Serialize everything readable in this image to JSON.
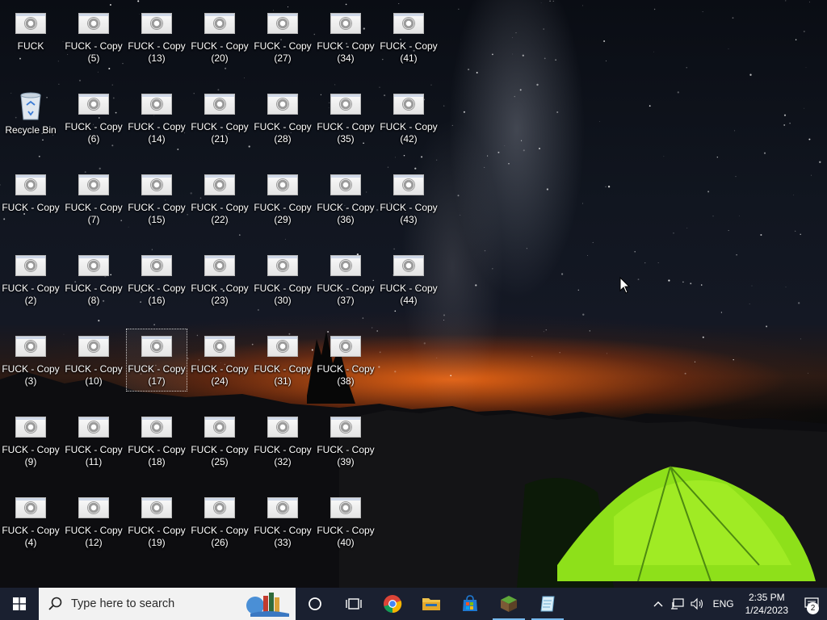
{
  "desktop": {
    "icons": [
      {
        "label": "FUCK"
      },
      {
        "label": "Recycle Bin"
      },
      {
        "label": "FUCK - Copy"
      },
      {
        "label": "FUCK - Copy\n(2)"
      },
      {
        "label": "FUCK - Copy\n(3)"
      },
      {
        "label": "FUCK - Copy\n(9)"
      },
      {
        "label": "FUCK - Copy\n(4)"
      },
      {
        "label": "FUCK - Copy\n(5)"
      },
      {
        "label": "FUCK - Copy\n(6)"
      },
      {
        "label": "FUCK - Copy\n(7)"
      },
      {
        "label": "FUCK - Copy\n(8)"
      },
      {
        "label": "FUCK - Copy\n(10)"
      },
      {
        "label": "FUCK - Copy\n(11)"
      },
      {
        "label": "FUCK - Copy\n(12)"
      },
      {
        "label": "FUCK - Copy\n(13)"
      },
      {
        "label": "FUCK - Copy\n(14)"
      },
      {
        "label": "FUCK - Copy\n(15)"
      },
      {
        "label": "FUCK - Copy\n(16)"
      },
      {
        "label": "FUCK - Copy\n(17)",
        "selected": true
      },
      {
        "label": "FUCK - Copy\n(18)"
      },
      {
        "label": "FUCK - Copy\n(19)"
      },
      {
        "label": "FUCK - Copy\n(20)"
      },
      {
        "label": "FUCK - Copy\n(21)"
      },
      {
        "label": "FUCK - Copy\n(22)"
      },
      {
        "label": "FUCK - Copy\n(23)"
      },
      {
        "label": "FUCK - Copy\n(24)"
      },
      {
        "label": "FUCK - Copy\n(25)"
      },
      {
        "label": "FUCK - Copy\n(26)"
      },
      {
        "label": "FUCK - Copy\n(27)"
      },
      {
        "label": "FUCK - Copy\n(28)"
      },
      {
        "label": "FUCK - Copy\n(29)"
      },
      {
        "label": "FUCK - Copy\n(30)"
      },
      {
        "label": "FUCK - Copy\n(31)"
      },
      {
        "label": "FUCK - Copy\n(32)"
      },
      {
        "label": "FUCK - Copy\n(33)"
      },
      {
        "label": "FUCK - Copy\n(34)"
      },
      {
        "label": "FUCK - Copy\n(35)"
      },
      {
        "label": "FUCK - Copy\n(36)"
      },
      {
        "label": "FUCK - Copy\n(37)"
      },
      {
        "label": "FUCK - Copy\n(38)"
      },
      {
        "label": "FUCK - Copy\n(39)"
      },
      {
        "label": "FUCK - Copy\n(40)"
      },
      {
        "label": "FUCK - Copy\n(41)"
      },
      {
        "label": "FUCK - Copy\n(42)"
      },
      {
        "label": "FUCK - Copy\n(43)"
      },
      {
        "label": "FUCK - Copy\n(44)"
      }
    ]
  },
  "taskbar": {
    "search_placeholder": "Type here to search",
    "pinned": [
      "cortana-icon",
      "task-view-icon",
      "chrome-icon",
      "file-explorer-icon",
      "store-icon",
      "minecraft-icon",
      "notepad-icon"
    ],
    "tray": {
      "language": "ENG",
      "time": "2:35 PM",
      "date": "1/24/2023",
      "notification_count": "2"
    },
    "colors": {
      "background": "#1a2030",
      "active_indicator": "#76b9ed"
    }
  }
}
